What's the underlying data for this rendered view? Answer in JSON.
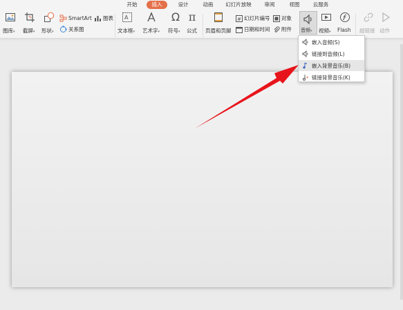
{
  "tabs": [
    "开始",
    "插入",
    "设计",
    "动画",
    "幻灯片放映",
    "审阅",
    "视图",
    "云服务"
  ],
  "active_tab": "插入",
  "ribbon": {
    "gallery": "图库",
    "screenshot": "截屏",
    "shapes": "形状",
    "smartart": "SmartArt",
    "chart": "图表",
    "relation": "关系图",
    "textbox": "文本框",
    "arttext": "艺术字",
    "symbol": "符号",
    "formula": "公式",
    "header_footer": "页眉和页脚",
    "slide_number": "幻灯片编号",
    "object": "对象",
    "datetime": "日期和时间",
    "attachment": "附件",
    "audio": "音频",
    "video": "视频",
    "flash": "Flash",
    "hyperlink": "超链接",
    "action": "动作"
  },
  "audio_menu": {
    "items": [
      "嵌入音频(S)",
      "链接到音频(L)",
      "嵌入背景音乐(B)",
      "链接背景音乐(K)"
    ],
    "highlighted_index": 2
  },
  "colors": {
    "accent": "#e4704a",
    "arrow": "#e8141b",
    "ribbon_bg": "#f4f4f4",
    "canvas_bg": "#ebebeb"
  }
}
